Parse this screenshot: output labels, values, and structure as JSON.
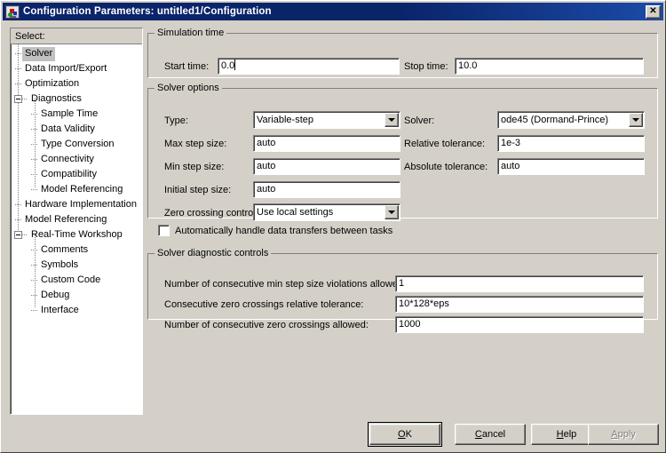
{
  "window": {
    "title": "Configuration Parameters: untitled1/Configuration",
    "icon": "simulink-icon",
    "close_label": "✕"
  },
  "sidebar": {
    "header": "Select:",
    "items": [
      {
        "label": "Solver",
        "level": 1,
        "selected": true,
        "expander": "none"
      },
      {
        "label": "Data Import/Export",
        "level": 1,
        "selected": false,
        "expander": "none"
      },
      {
        "label": "Optimization",
        "level": 1,
        "selected": false,
        "expander": "none"
      },
      {
        "label": "Diagnostics",
        "level": 1,
        "selected": false,
        "expander": "minus"
      },
      {
        "label": "Sample Time",
        "level": 2,
        "selected": false,
        "expander": "none"
      },
      {
        "label": "Data Validity",
        "level": 2,
        "selected": false,
        "expander": "none"
      },
      {
        "label": "Type Conversion",
        "level": 2,
        "selected": false,
        "expander": "none"
      },
      {
        "label": "Connectivity",
        "level": 2,
        "selected": false,
        "expander": "none"
      },
      {
        "label": "Compatibility",
        "level": 2,
        "selected": false,
        "expander": "none"
      },
      {
        "label": "Model Referencing",
        "level": 2,
        "selected": false,
        "expander": "none"
      },
      {
        "label": "Hardware Implementation",
        "level": 1,
        "selected": false,
        "expander": "none"
      },
      {
        "label": "Model Referencing",
        "level": 1,
        "selected": false,
        "expander": "none"
      },
      {
        "label": "Real-Time Workshop",
        "level": 1,
        "selected": false,
        "expander": "minus"
      },
      {
        "label": "Comments",
        "level": 2,
        "selected": false,
        "expander": "none"
      },
      {
        "label": "Symbols",
        "level": 2,
        "selected": false,
        "expander": "none"
      },
      {
        "label": "Custom Code",
        "level": 2,
        "selected": false,
        "expander": "none"
      },
      {
        "label": "Debug",
        "level": 2,
        "selected": false,
        "expander": "none"
      },
      {
        "label": "Interface",
        "level": 2,
        "selected": false,
        "expander": "none"
      }
    ]
  },
  "simulation_time": {
    "legend": "Simulation time",
    "start_label": "Start time:",
    "start_value": "0.0",
    "stop_label": "Stop time:",
    "stop_value": "10.0"
  },
  "solver_options": {
    "legend": "Solver options",
    "type_label": "Type:",
    "type_value": "Variable-step",
    "solver_label": "Solver:",
    "solver_value": "ode45 (Dormand-Prince)",
    "max_step_label": "Max step size:",
    "max_step_value": "auto",
    "rel_tol_label": "Relative tolerance:",
    "rel_tol_value": "1e-3",
    "min_step_label": "Min step size:",
    "min_step_value": "auto",
    "abs_tol_label": "Absolute tolerance:",
    "abs_tol_value": "auto",
    "init_step_label": "Initial step size:",
    "init_step_value": "auto",
    "zero_cross_label": "Zero crossing control:",
    "zero_cross_value": "Use local settings",
    "auto_transfer_label": "Automatically handle data transfers between tasks",
    "auto_transfer_checked": false
  },
  "solver_diagnostics": {
    "legend": "Solver diagnostic controls",
    "min_step_viol_label": "Number of consecutive min step size violations allowed:",
    "min_step_viol_value": "1",
    "zero_cross_rel_tol_label": "Consecutive zero crossings relative tolerance:",
    "zero_cross_rel_tol_value": "10*128*eps",
    "zero_cross_allowed_label": "Number of consecutive zero crossings allowed:",
    "zero_cross_allowed_value": "1000"
  },
  "buttons": {
    "ok": {
      "pre": "",
      "mn": "O",
      "post": "K",
      "disabled": false,
      "default": true
    },
    "cancel": {
      "pre": "",
      "mn": "C",
      "post": "ancel",
      "disabled": false,
      "default": false
    },
    "help": {
      "pre": "",
      "mn": "H",
      "post": "elp",
      "disabled": false,
      "default": false
    },
    "apply": {
      "pre": "",
      "mn": "A",
      "post": "pply",
      "disabled": true,
      "default": false
    }
  },
  "colors": {
    "face": "#d4d0c8",
    "titlebar": "#0a246a",
    "field": "#ffffff",
    "selection": "#c0c0c0",
    "disabled_text": "#808080"
  }
}
